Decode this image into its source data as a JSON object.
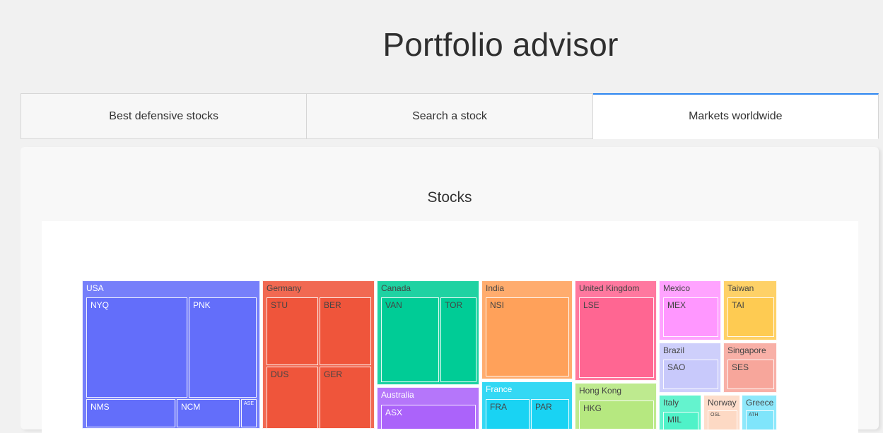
{
  "page": {
    "title": "Portfolio advisor"
  },
  "tabs": [
    {
      "label": "Best defensive stocks",
      "active": false
    },
    {
      "label": "Search a stock",
      "active": false
    },
    {
      "label": "Markets worldwide",
      "active": true
    }
  ],
  "panel": {
    "title": "Stocks"
  },
  "colors": {
    "active_tab_border": "#2e86f0",
    "USA": "#636efa",
    "Germany": "#ef553b",
    "Canada": "#00cc96",
    "Australia": "#ab63fa",
    "India": "#ffa15a",
    "France": "#19d3f3",
    "United Kingdom": "#ff6692",
    "Hong Kong": "#b6e880",
    "Mexico": "#ff97ff",
    "Taiwan": "#fecb52",
    "Brazil": "#c8c9fb",
    "Singapore": "#f7a69b",
    "Italy": "#4ff2c8",
    "Norway": "#fdd9c4",
    "Greece": "#7fe5fb"
  },
  "chart_data": {
    "type": "treemap",
    "title": "Stocks",
    "groups": [
      {
        "name": "USA",
        "children": [
          "NYQ",
          "PNK",
          "NMS",
          "NCM",
          "ASE"
        ]
      },
      {
        "name": "Germany",
        "children": [
          "STU",
          "BER",
          "DUS",
          "GER"
        ]
      },
      {
        "name": "Canada",
        "children": [
          "VAN",
          "TOR"
        ]
      },
      {
        "name": "Australia",
        "children": [
          "ASX"
        ]
      },
      {
        "name": "India",
        "children": [
          "NSI"
        ]
      },
      {
        "name": "France",
        "children": [
          "FRA",
          "PAR"
        ]
      },
      {
        "name": "United Kingdom",
        "children": [
          "LSE"
        ]
      },
      {
        "name": "Hong Kong",
        "children": [
          "HKG"
        ]
      },
      {
        "name": "Mexico",
        "children": [
          "MEX"
        ]
      },
      {
        "name": "Taiwan",
        "children": [
          "TAI"
        ]
      },
      {
        "name": "Brazil",
        "children": [
          "SAO"
        ]
      },
      {
        "name": "Singapore",
        "children": [
          "SES"
        ]
      },
      {
        "name": "Italy",
        "children": [
          "MIL"
        ]
      },
      {
        "name": "Norway",
        "children": [
          "OSL"
        ]
      },
      {
        "name": "Greece",
        "children": [
          "ATH"
        ]
      }
    ]
  }
}
